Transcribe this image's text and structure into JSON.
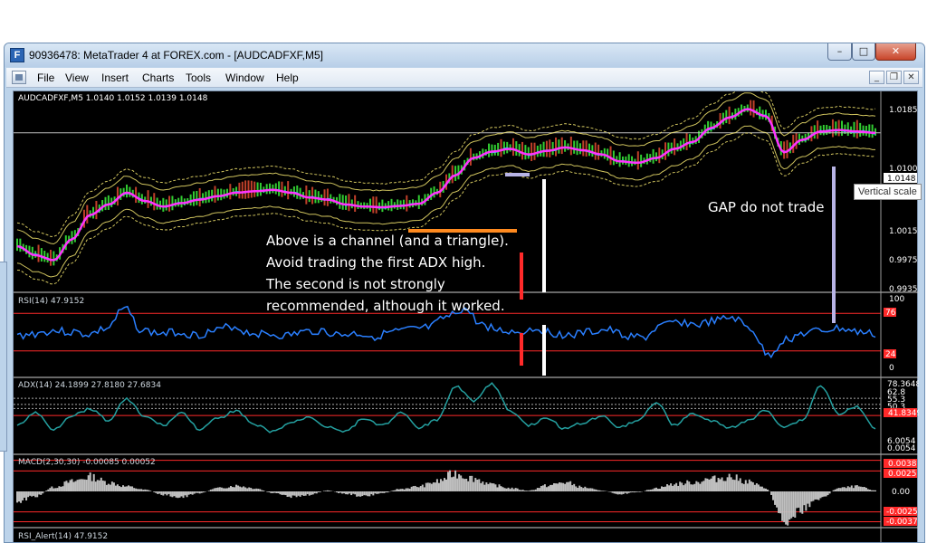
{
  "window": {
    "title": "90936478: MetaTrader 4 at FOREX.com - [AUDCADFXF,M5]",
    "icon": "F",
    "min_glyph": "–",
    "max_glyph": "□",
    "close_glyph": "✕"
  },
  "menu": {
    "items": [
      "File",
      "View",
      "Insert",
      "Charts",
      "Tools",
      "Window",
      "Help"
    ],
    "mdi_min": "_",
    "mdi_restore": "❐",
    "mdi_close": "✕"
  },
  "colors": {
    "background": "#000000",
    "price_line": "#ff33ff",
    "candles": "#32cd32",
    "fast_line": "#00e5e5",
    "bands": "#f5e66e",
    "rsi_line": "#2a7fff",
    "adx_line": "#24a0a0",
    "macd_hist": "#c0c0c0",
    "level_line": "#ff2a2a",
    "annotation_orange": "#ff8a1f",
    "annotation_red": "#ff2a2a",
    "annotation_white": "#ffffff",
    "annotation_lavender": "#b8b4e6"
  },
  "panels": {
    "price": {
      "label": "AUDCADFXF,M5  1.0140 1.0152 1.0139 1.0148",
      "ticks": [
        "1.0185",
        "1.0100",
        "1.0015",
        "0.9975",
        "0.9935"
      ],
      "current": "1.0148"
    },
    "rsi": {
      "label": "RSI(14) 47.9152",
      "ticks": [
        "100",
        "0"
      ],
      "levels": [
        "76",
        "24"
      ]
    },
    "adx": {
      "label": "ADX(14) 24.1899 27.8180 27.6834",
      "ticks": [
        "78.3648",
        "62.8",
        "55.3",
        "50.3",
        "6.0054",
        "0.0054"
      ],
      "level": "41.8349"
    },
    "macd": {
      "label": "MACD(2,30,30) -0.00085 0.00052",
      "ticks": [
        "0.00"
      ],
      "levels": [
        "0.0038",
        "0.0025",
        "-0.0025",
        "-0.0037"
      ]
    },
    "extra": {
      "label": "RSI_Alert(14) 47.9152"
    }
  },
  "notes": {
    "channel": [
      "Above is a channel (and a triangle).",
      "Avoid trading the first ADX high.",
      "The second is not strongly",
      "recommended, although it worked."
    ],
    "gap": "GAP do not trade"
  },
  "tooltip": "Vertical scale",
  "chart_data": {
    "type": "line",
    "title": "",
    "symbol": "AUDCADFXF",
    "timeframe": "M5",
    "ohlc_last": {
      "open": 1.014,
      "high": 1.0152,
      "low": 1.0139,
      "close": 1.0148
    },
    "price_ylim": [
      0.992,
      1.0205
    ],
    "price_ticks": [
      1.0185,
      1.01,
      1.0015,
      0.9975,
      0.9935
    ],
    "price_current": 1.0148,
    "x": [
      0,
      20,
      40,
      60,
      80,
      100,
      120,
      140,
      160,
      180,
      200,
      220,
      240,
      260,
      280,
      300,
      320,
      340,
      360,
      380,
      400,
      420,
      440,
      460,
      480,
      500,
      520,
      540,
      560,
      580,
      600,
      620,
      640,
      660,
      680,
      700,
      720,
      740,
      760,
      780,
      800,
      820,
      840,
      860,
      880,
      900,
      920,
      940
    ],
    "series": [
      {
        "name": "",
        "values": [
          0.9985,
          0.9972,
          0.9965,
          0.9995,
          1.003,
          1.0045,
          1.0062,
          1.005,
          1.0042,
          1.0047,
          1.0052,
          1.0057,
          1.0062,
          1.0064,
          1.0066,
          1.0062,
          1.0055,
          1.0052,
          1.0045,
          1.0042,
          1.0041,
          1.0043,
          1.0046,
          1.0062,
          1.0087,
          1.0112,
          1.0121,
          1.0125,
          1.0117,
          1.0122,
          1.0127,
          1.0123,
          1.0117,
          1.0107,
          1.0105,
          1.0112,
          1.0125,
          1.0135,
          1.0155,
          1.017,
          1.0182,
          1.0172,
          1.012,
          1.0138,
          1.015,
          1.0152,
          1.015,
          1.0148
        ]
      }
    ],
    "rsi": {
      "ylim": [
        0,
        100
      ],
      "levels": [
        76,
        24
      ],
      "values": [
        45,
        48,
        52,
        50,
        47,
        55,
        82,
        52,
        48,
        50,
        46,
        51,
        58,
        49,
        47,
        45,
        50,
        52,
        46,
        48,
        44,
        50,
        53,
        56,
        70,
        82,
        60,
        52,
        50,
        55,
        48,
        46,
        50,
        53,
        45,
        42,
        58,
        64,
        60,
        65,
        70,
        55,
        18,
        40,
        48,
        52,
        55,
        50,
        47
      ]
    },
    "adx": {
      "ylim": [
        0,
        85
      ],
      "level": 41.8349,
      "values": [
        30,
        45,
        25,
        42,
        50,
        36,
        62,
        40,
        30,
        45,
        25,
        38,
        48,
        30,
        22,
        33,
        40,
        28,
        23,
        38,
        30,
        45,
        27,
        36,
        78,
        60,
        80,
        48,
        30,
        38,
        26,
        33,
        41,
        28,
        36,
        58,
        30,
        44,
        35,
        27,
        35,
        48,
        28,
        36,
        78,
        44,
        52,
        25
      ]
    },
    "macd": {
      "ylim": [
        -0.0042,
        0.0042
      ],
      "levels": [
        0.0038,
        0.0025,
        -0.0025,
        -0.0037
      ],
      "values": [
        -0.0012,
        -0.0006,
        0.0005,
        0.0012,
        0.0018,
        0.0011,
        0.0006,
        0.0002,
        -0.0004,
        -0.0007,
        -0.0002,
        0.0004,
        0.0007,
        0.0004,
        -0.0002,
        -0.0007,
        -0.0004,
        0.0001,
        -0.0003,
        -0.0006,
        -0.0002,
        0.0003,
        0.0006,
        0.0012,
        0.0022,
        0.0016,
        0.0008,
        0.0004,
        0.0001,
        0.0007,
        0.0011,
        0.0005,
        0.0001,
        -0.0003,
        -0.0001,
        0.0004,
        0.0009,
        0.0011,
        0.0015,
        0.0018,
        0.0012,
        0.0004,
        -0.0034,
        -0.0022,
        -0.0008,
        0.0004,
        0.0006,
        0.0001
      ]
    }
  }
}
